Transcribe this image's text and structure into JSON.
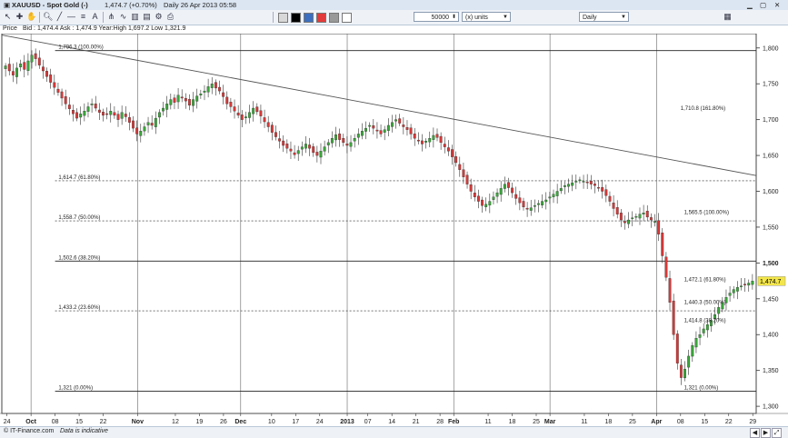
{
  "window": {
    "title": "XAUUSD - Spot Gold (-)",
    "quote": "1,474.7 (+0.70%)",
    "period_date": "Daily  26 Apr 2013 05:58"
  },
  "toolbar": {
    "quantity_value": "50000",
    "units_label": "(x) units",
    "timeframe_value": "Daily",
    "icons": [
      "cursor-icon",
      "crosshair-icon",
      "hand-icon",
      "zoom-icon",
      "trendline-icon",
      "line-icon",
      "fibonacci-icon",
      "text-icon",
      "chart-type-icon",
      "indicator-icon",
      "bars-icon",
      "save-icon",
      "settings-icon",
      "print-icon"
    ],
    "swatch_colors": [
      "#d8d8d8",
      "#000000",
      "#3c6fbf",
      "#e23b3b",
      "#999999",
      "#ffffff"
    ]
  },
  "info": {
    "price_label": "Price",
    "bid_ask_text": "Bid : 1,474.4 Ask : 1,474.9 Year:High 1,697.2 Low 1,321.9"
  },
  "footer": {
    "source_text": "© IT-Finance.com",
    "note_text": "Data is indicative"
  },
  "colors": {
    "up": "#3aa63a",
    "down": "#d83838",
    "wick": "#333333",
    "current_price_bg": "#f3e64a",
    "frame": "#444444"
  },
  "chart_data": {
    "type": "candlestick",
    "symbol": "XAUUSD",
    "timeframe": "Daily",
    "ylim": [
      1290,
      1820
    ],
    "y_ticks": [
      1800,
      1750,
      1700,
      1650,
      1600,
      1550,
      1500,
      1450,
      1400,
      1350,
      1300
    ],
    "y_tick_labels": [
      "1,800",
      "1,750",
      "1,700",
      "1,650",
      "1,600",
      "1,550",
      "1,500",
      "1,450",
      "1,400",
      "1,350",
      "1,300"
    ],
    "current_price": 1474.7,
    "current_price_label": "1,474.7",
    "x_ticks": [
      {
        "label": "24",
        "day": 0
      },
      {
        "label": "Oct",
        "day": 7,
        "bold": true
      },
      {
        "label": "08",
        "day": 14
      },
      {
        "label": "15",
        "day": 21
      },
      {
        "label": "22",
        "day": 28
      },
      {
        "label": "Nov",
        "day": 38,
        "bold": true
      },
      {
        "label": "12",
        "day": 49
      },
      {
        "label": "19",
        "day": 56
      },
      {
        "label": "26",
        "day": 63
      },
      {
        "label": "Dec",
        "day": 68,
        "bold": true
      },
      {
        "label": "10",
        "day": 77
      },
      {
        "label": "17",
        "day": 84
      },
      {
        "label": "24",
        "day": 91
      },
      {
        "label": "2013",
        "day": 99,
        "bold": true
      },
      {
        "label": "07",
        "day": 105
      },
      {
        "label": "14",
        "day": 112
      },
      {
        "label": "21",
        "day": 119
      },
      {
        "label": "28",
        "day": 126
      },
      {
        "label": "Feb",
        "day": 130,
        "bold": true
      },
      {
        "label": "11",
        "day": 140
      },
      {
        "label": "18",
        "day": 147
      },
      {
        "label": "25",
        "day": 154
      },
      {
        "label": "Mar",
        "day": 158,
        "bold": true
      },
      {
        "label": "11",
        "day": 168
      },
      {
        "label": "18",
        "day": 175
      },
      {
        "label": "25",
        "day": 182
      },
      {
        "label": "Apr",
        "day": 189,
        "bold": true
      },
      {
        "label": "08",
        "day": 196
      },
      {
        "label": "15",
        "day": 203
      },
      {
        "label": "22",
        "day": 210
      },
      {
        "label": "29",
        "day": 217
      }
    ],
    "x_range_days": [
      -1.5,
      218
    ],
    "month_dividers_days": [
      7,
      38,
      68,
      99,
      130,
      158,
      189
    ],
    "candles_close": [
      1775,
      1768,
      1762,
      1772,
      1778,
      1770,
      1782,
      1790,
      1785,
      1776,
      1768,
      1760,
      1752,
      1745,
      1738,
      1730,
      1722,
      1715,
      1708,
      1702,
      1708,
      1712,
      1718,
      1722,
      1716,
      1710,
      1706,
      1708,
      1712,
      1706,
      1700,
      1710,
      1704,
      1696,
      1688,
      1680,
      1684,
      1690,
      1696,
      1692,
      1702,
      1710,
      1716,
      1722,
      1728,
      1724,
      1734,
      1730,
      1726,
      1720,
      1728,
      1733,
      1736,
      1740,
      1746,
      1750,
      1744,
      1740,
      1732,
      1722,
      1718,
      1712,
      1706,
      1700,
      1704,
      1710,
      1716,
      1711,
      1705,
      1697,
      1690,
      1682,
      1676,
      1670,
      1664,
      1660,
      1656,
      1651,
      1657,
      1662,
      1666,
      1660,
      1654,
      1650,
      1656,
      1662,
      1668,
      1674,
      1679,
      1672,
      1668,
      1664,
      1668,
      1674,
      1680,
      1684,
      1688,
      1692,
      1688,
      1684,
      1680,
      1686,
      1692,
      1696,
      1700,
      1695,
      1690,
      1686,
      1680,
      1674,
      1670,
      1666,
      1670,
      1674,
      1678,
      1675,
      1668,
      1662,
      1656,
      1648,
      1640,
      1630,
      1620,
      1610,
      1600,
      1592,
      1586,
      1580,
      1582,
      1586,
      1592,
      1598,
      1604,
      1610,
      1605,
      1598,
      1590,
      1584,
      1578,
      1575,
      1577,
      1580,
      1583,
      1586,
      1588,
      1592,
      1596,
      1600,
      1604,
      1608,
      1610,
      1612,
      1614,
      1616,
      1614,
      1612,
      1610,
      1608,
      1605,
      1600,
      1594,
      1586,
      1576,
      1568,
      1560,
      1556,
      1560,
      1563,
      1565,
      1568,
      1570,
      1564,
      1560,
      1558,
      1540,
      1510,
      1480,
      1445,
      1400,
      1360,
      1340,
      1352,
      1370,
      1385,
      1395,
      1400,
      1408,
      1414,
      1420,
      1428,
      1438,
      1445,
      1452,
      1458,
      1463,
      1466,
      1468,
      1470,
      1472,
      1474.7
    ],
    "fib_levels": [
      {
        "value": 1796.3,
        "label": "1,796.3 (100.00%)",
        "style": "solid",
        "x_from_day": 14,
        "label_day": 15
      },
      {
        "value": 1614.7,
        "label": "1,614.7 (61.80%)",
        "style": "dotted",
        "x_from_day": 14,
        "label_day": 15
      },
      {
        "value": 1558.7,
        "label": "1,558.7 (50.00%)",
        "style": "dotted",
        "x_from_day": 14,
        "label_day": 15
      },
      {
        "value": 1502.6,
        "label": "1,502.6 (38.20%)",
        "style": "solid",
        "x_from_day": 14,
        "label_day": 15
      },
      {
        "value": 1433.2,
        "label": "1,433.2 (23.60%)",
        "style": "dotted",
        "x_from_day": 14,
        "label_day": 15
      },
      {
        "value": 1321.0,
        "label": "1,321 (0.00%)",
        "style": "solid",
        "x_from_day": 14,
        "label_day": 15
      }
    ],
    "fib_levels_right": [
      {
        "value": 1710.8,
        "label": "1,710.8 (161.80%)",
        "label_day": 196
      },
      {
        "value": 1565.5,
        "label": "1,565.5 (100.00%)",
        "label_day": 197
      },
      {
        "value": 1472.1,
        "label": "1,472.1 (61.80%)",
        "label_day": 197
      },
      {
        "value": 1440.3,
        "label": "1,440.3 (50.00%)",
        "label_day": 197
      },
      {
        "value": 1414.8,
        "label": "1,414.8 (38.20%)",
        "label_day": 197
      },
      {
        "value": 1321.0,
        "label": "1,321 (0.00%)",
        "label_day": 197
      }
    ],
    "trendline": {
      "from": {
        "day": -1.5,
        "value": 1818
      },
      "to": {
        "day": 218,
        "value": 1622
      }
    },
    "grid": false,
    "legend": "none"
  }
}
